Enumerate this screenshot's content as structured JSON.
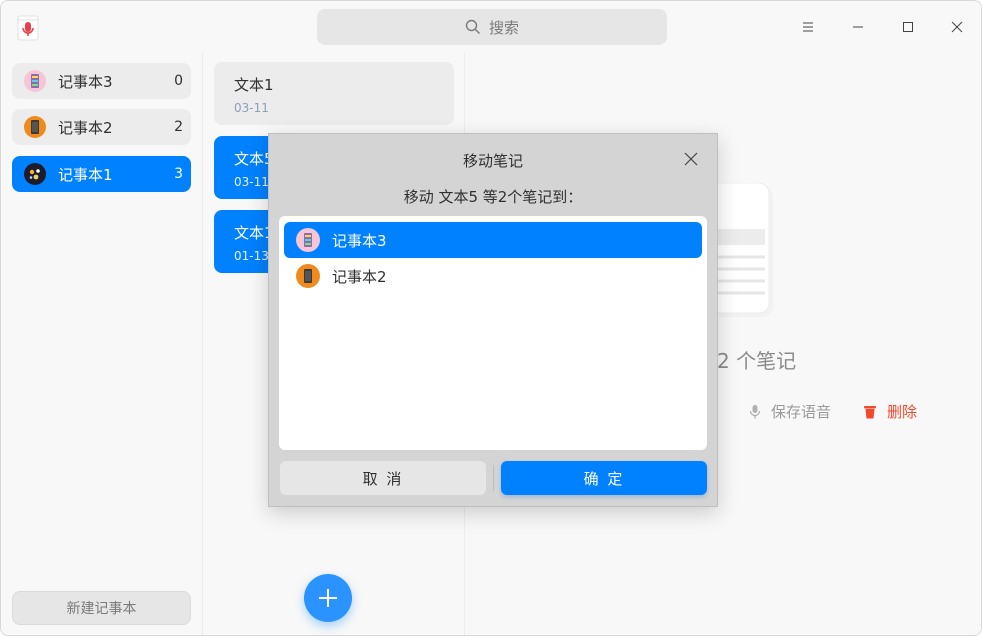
{
  "search": {
    "placeholder": "搜索"
  },
  "notebooks": [
    {
      "name": "记事本3",
      "count": "0"
    },
    {
      "name": "记事本2",
      "count": "2"
    },
    {
      "name": "记事本1",
      "count": "3"
    }
  ],
  "sidebar": {
    "new_notebook_label": "新建记事本"
  },
  "notes": [
    {
      "title": "文本1",
      "date": "03-11"
    },
    {
      "title": "文本5",
      "date": "03-11"
    },
    {
      "title": "文本1",
      "date": "01-13"
    }
  ],
  "detail": {
    "selection_count": "2 个笔记",
    "save_voice_label": "保存语音",
    "delete_label": "删除"
  },
  "dialog": {
    "title": "移动笔记",
    "message": "移动 文本5 等2个笔记到：",
    "items": [
      {
        "name": "记事本3"
      },
      {
        "name": "记事本2"
      }
    ],
    "cancel_label": "取 消",
    "confirm_label": "确 定"
  },
  "colors": {
    "accent": "#0081ff",
    "danger": "#f2482d"
  }
}
